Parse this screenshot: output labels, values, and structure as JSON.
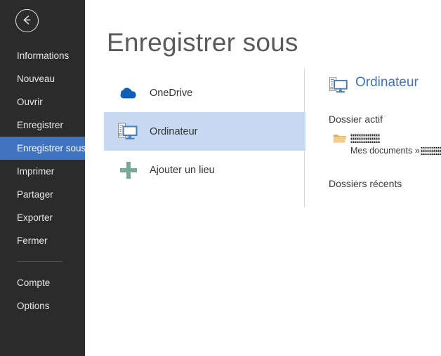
{
  "window": {
    "app_screen": "Backstage - Enregistrer sous"
  },
  "sidebar": {
    "back_button": {
      "icon": "back-arrow-icon",
      "label": "Retour"
    },
    "items": [
      {
        "label": "Informations",
        "selected": false
      },
      {
        "label": "Nouveau",
        "selected": false
      },
      {
        "label": "Ouvrir",
        "selected": false
      },
      {
        "label": "Enregistrer",
        "selected": false
      },
      {
        "label": "Enregistrer sous",
        "selected": true
      },
      {
        "label": "Imprimer",
        "selected": false
      },
      {
        "label": "Partager",
        "selected": false
      },
      {
        "label": "Exporter",
        "selected": false
      },
      {
        "label": "Fermer",
        "selected": false
      }
    ],
    "footer_items": [
      {
        "label": "Compte"
      },
      {
        "label": "Options"
      }
    ],
    "colors": {
      "background": "#2b2b2b",
      "text": "#e6e6e6",
      "selected_background": "#3f72bf",
      "separator": "#585858"
    }
  },
  "main": {
    "title": "Enregistrer sous",
    "places": [
      {
        "label": "OneDrive",
        "icon": "onedrive-cloud-icon",
        "selected": false
      },
      {
        "label": "Ordinateur",
        "icon": "computer-icon",
        "selected": true
      },
      {
        "label": "Ajouter un lieu",
        "icon": "plus-icon",
        "selected": false
      }
    ],
    "place_colors": {
      "onedrive": "#0f5fba",
      "computer_outline": "#4a7ebb",
      "add_place_plus": "#7aa99a",
      "selected_row": "#c7d9f1"
    }
  },
  "detail": {
    "header": {
      "title": "Ordinateur",
      "icon": "computer-icon",
      "color": "#3f72bf"
    },
    "current_folder_section": {
      "title": "Dossier actif",
      "folder_icon": "open-folder-icon",
      "folder_name": "",
      "folder_name_redacted": true,
      "path_prefix": "Mes documents »",
      "path_suffix": "",
      "path_suffix_redacted": true
    },
    "recent_folders_section": {
      "title": "Dossiers récents",
      "items": []
    }
  }
}
